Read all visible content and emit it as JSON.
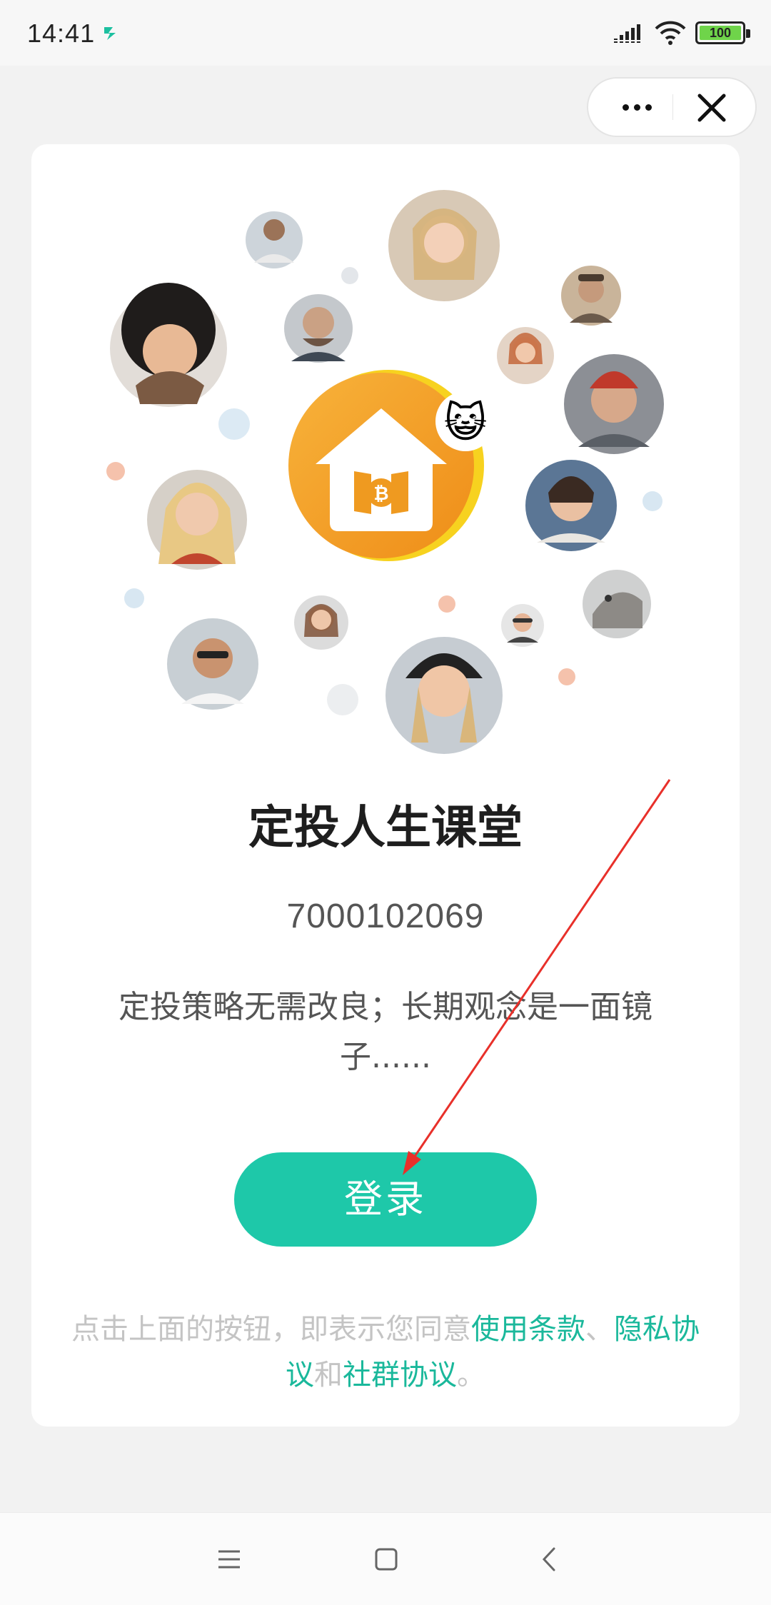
{
  "status_bar": {
    "time": "14:41",
    "battery": "100",
    "icons": [
      "app-notification-icon",
      "signal-icon",
      "wifi-icon",
      "battery-icon"
    ]
  },
  "capsule": {
    "more_icon": "more-dots-icon",
    "close_icon": "close-icon"
  },
  "illustration": {
    "center_logo": "house-coin-logo",
    "badge": "cat-emoji-icon",
    "badge_glyph": "😺",
    "coin_glyph": "₿",
    "avatars": 16
  },
  "card": {
    "title": "定投人生课堂",
    "id": "7000102069",
    "description": "定投策略无需改良；长期观念是一面镜子......",
    "login_label": "登录",
    "agreement": {
      "prefix": "点击上面的按钮，即表示您同意",
      "terms": "使用条款",
      "sep1": "、",
      "privacy": "隐私协议",
      "and": "和",
      "community": "社群协议",
      "suffix": "。"
    }
  },
  "colors": {
    "accent": "#1ec8a9",
    "link": "#1ab89b",
    "logo_orange": "#f5a623",
    "logo_yellow": "#f7d21f",
    "annotation_arrow": "#e8302a"
  },
  "nav_bar": {
    "icons": [
      "menu-icon",
      "home-icon",
      "back-icon"
    ]
  }
}
